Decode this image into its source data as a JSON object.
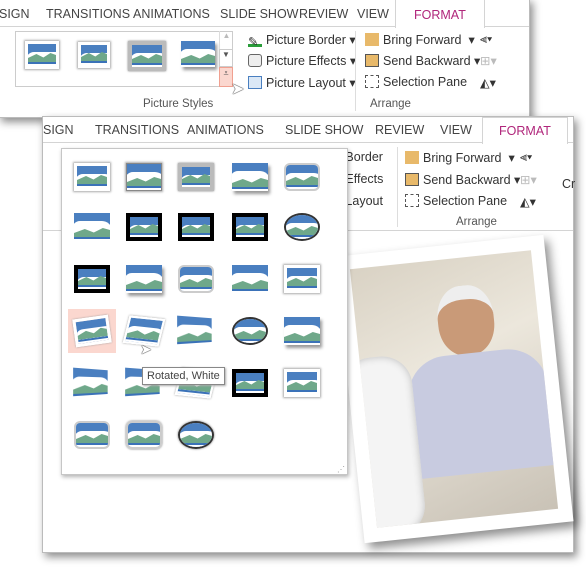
{
  "ribbon": {
    "tabs": [
      "SIGN",
      "TRANSITIONS",
      "ANIMATIONS",
      "SLIDE SHOW",
      "REVIEW",
      "VIEW",
      "FORMAT"
    ],
    "active_tab": "FORMAT",
    "picture_border": "Picture Border",
    "picture_effects": "Picture Effects",
    "picture_layout": "Picture Layout",
    "picture_styles_group": "Picture Styles",
    "bring_forward": "Bring Forward",
    "send_backward": "Send Backward",
    "selection_pane": "Selection Pane",
    "arrange_group": "Arrange",
    "border_partial": "e Border",
    "effects_partial": "e Effects",
    "layout_partial": "e Layout",
    "crop_partial": "Cr"
  },
  "gallery": {
    "tooltip": "Rotated, White",
    "hovered_index": 6,
    "styles": [
      "Simple Frame, White",
      "Simple Frame, White 2",
      "Beveled Matte, White",
      "Drop Shadow Rectangle",
      "Reflected Rounded Rectangle",
      "Soft Edge Rectangle",
      "Double Frame, Black",
      "Thick Matte, Black",
      "Simple Frame, Black",
      "Beveled Oval, Black",
      "Compound Frame, Black",
      "Center Shadow Rectangle",
      "Rounded Diagonal Corner, White",
      "Snip Diagonal Corner, White",
      "Moderate Frame, White",
      "Rotated, White",
      "Perspective Shadow, White",
      "Relaxed Perspective, White",
      "Soft Edge Oval",
      "Bevel Rectangle",
      "Bevel Perspective",
      "Reflected Perspective Right",
      "Bevel Perspective Left, White",
      "Reflected Bevel, Black",
      "Reflected Bevel, White",
      "Metal Rounded Rectangle",
      "Metal Oval",
      "Metal Frame"
    ]
  },
  "colors": {
    "accent": "#b0267b",
    "hover": "#fbd7cf",
    "sky": "#4a7fc0",
    "hill": "#6fa88a"
  }
}
